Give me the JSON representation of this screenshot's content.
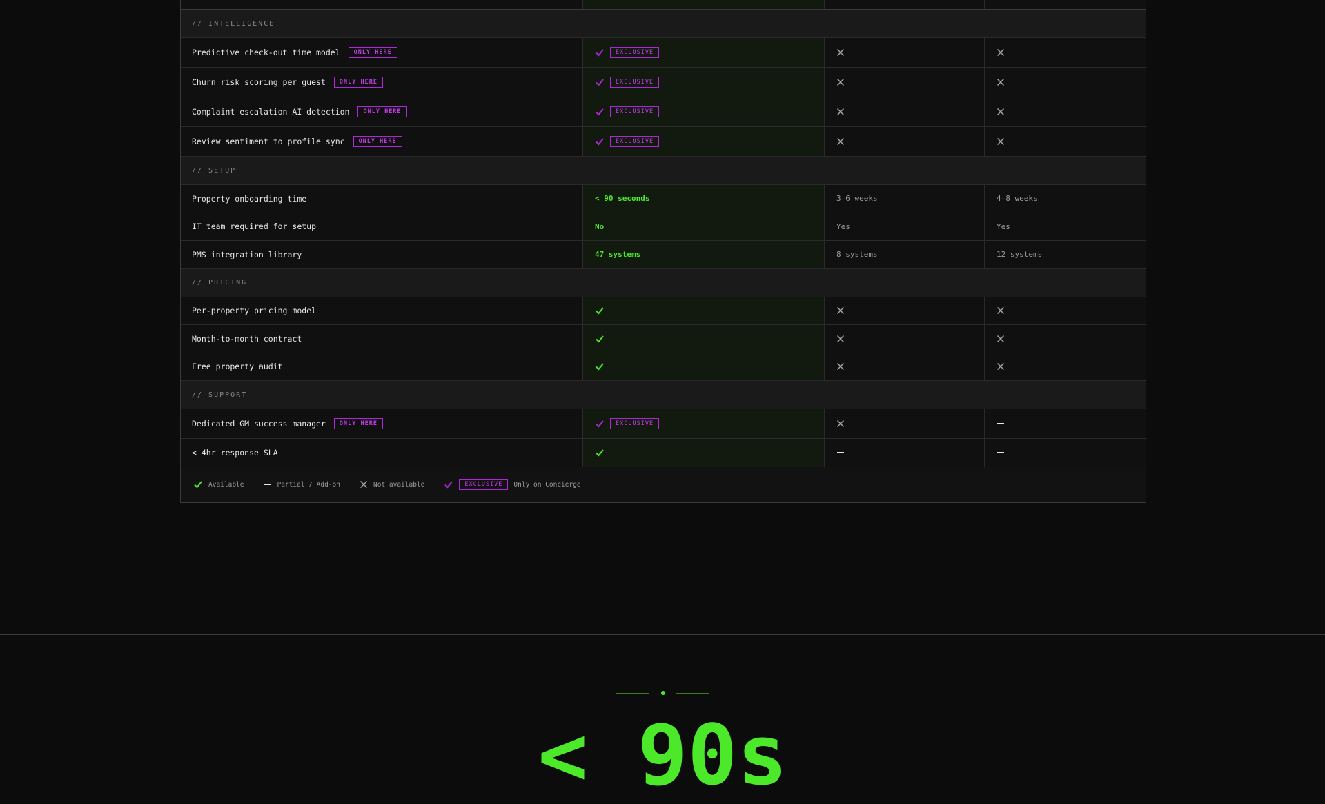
{
  "sections": [
    {
      "label": "// INTELLIGENCE",
      "rows": [
        {
          "feature": "Predictive check-out time model",
          "badge": "ONLY HERE",
          "concierge": {
            "type": "check",
            "tag": "EXCLUSIVE"
          },
          "comp1": {
            "type": "x"
          },
          "comp2": {
            "type": "x"
          }
        },
        {
          "feature": "Churn risk scoring per guest",
          "badge": "ONLY HERE",
          "concierge": {
            "type": "check",
            "tag": "EXCLUSIVE"
          },
          "comp1": {
            "type": "x"
          },
          "comp2": {
            "type": "x"
          }
        },
        {
          "feature": "Complaint escalation AI detection",
          "badge": "ONLY HERE",
          "concierge": {
            "type": "check",
            "tag": "EXCLUSIVE"
          },
          "comp1": {
            "type": "x"
          },
          "comp2": {
            "type": "x"
          }
        },
        {
          "feature": "Review sentiment to profile sync",
          "badge": "ONLY HERE",
          "concierge": {
            "type": "check",
            "tag": "EXCLUSIVE"
          },
          "comp1": {
            "type": "x"
          },
          "comp2": {
            "type": "x"
          }
        }
      ]
    },
    {
      "label": "// SETUP",
      "rows": [
        {
          "feature": "Property onboarding time",
          "concierge": {
            "type": "text",
            "text": "< 90 seconds"
          },
          "comp1": {
            "type": "text",
            "text": "3–6 weeks"
          },
          "comp2": {
            "type": "text",
            "text": "4–8 weeks"
          }
        },
        {
          "feature": "IT team required for setup",
          "concierge": {
            "type": "text",
            "text": "No"
          },
          "comp1": {
            "type": "text",
            "text": "Yes"
          },
          "comp2": {
            "type": "text",
            "text": "Yes"
          }
        },
        {
          "feature": "PMS integration library",
          "concierge": {
            "type": "text",
            "text": "47 systems"
          },
          "comp1": {
            "type": "text",
            "text": "8 systems"
          },
          "comp2": {
            "type": "text",
            "text": "12 systems"
          }
        }
      ]
    },
    {
      "label": "// PRICING",
      "rows": [
        {
          "feature": "Per-property pricing model",
          "concierge": {
            "type": "check"
          },
          "comp1": {
            "type": "x"
          },
          "comp2": {
            "type": "x"
          }
        },
        {
          "feature": "Month-to-month contract",
          "concierge": {
            "type": "check"
          },
          "comp1": {
            "type": "x"
          },
          "comp2": {
            "type": "x"
          }
        },
        {
          "feature": "Free property audit",
          "concierge": {
            "type": "check"
          },
          "comp1": {
            "type": "x"
          },
          "comp2": {
            "type": "x"
          }
        }
      ]
    },
    {
      "label": "// SUPPORT",
      "rows": [
        {
          "feature": "Dedicated GM success manager",
          "badge": "ONLY HERE",
          "concierge": {
            "type": "check",
            "tag": "EXCLUSIVE"
          },
          "comp1": {
            "type": "x"
          },
          "comp2": {
            "type": "dash"
          }
        },
        {
          "feature": "< 4hr response SLA",
          "concierge": {
            "type": "check"
          },
          "comp1": {
            "type": "dash"
          },
          "comp2": {
            "type": "dash"
          }
        }
      ]
    }
  ],
  "legend": {
    "available": "Available",
    "partial": "Partial / Add-on",
    "not_available": "Not available",
    "exclusive_tag": "EXCLUSIVE",
    "exclusive_label": "Only on Concierge"
  },
  "hero": {
    "big_text": "< 90s"
  },
  "colors": {
    "accent_green": "#4ce82a",
    "accent_purple": "#b026d9",
    "background": "#0c0c0c"
  },
  "icons": {
    "check": "check-icon",
    "x": "x-icon",
    "dash": "dash-icon"
  }
}
